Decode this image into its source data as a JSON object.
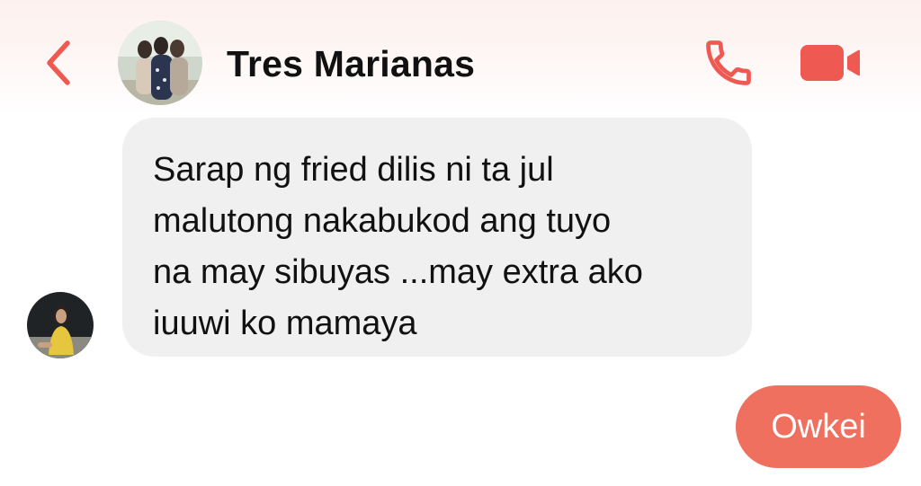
{
  "header": {
    "title": "Tres Marianas",
    "back_icon": "chevron-left-icon",
    "call_icon": "phone-icon",
    "video_icon": "video-camera-icon",
    "accent_color": "#ee5a52"
  },
  "messages": [
    {
      "direction": "incoming",
      "lines": [
        "Sarap ng fried dilis ni ta jul",
        "malutong nakabukod ang tuyo",
        "na may sibuyas ...may extra ako",
        "iuuwi ko mamaya"
      ],
      "bubble_color": "#f0f0f0"
    },
    {
      "direction": "outgoing",
      "text": "Owkei",
      "bubble_color": "#f0705f"
    }
  ]
}
